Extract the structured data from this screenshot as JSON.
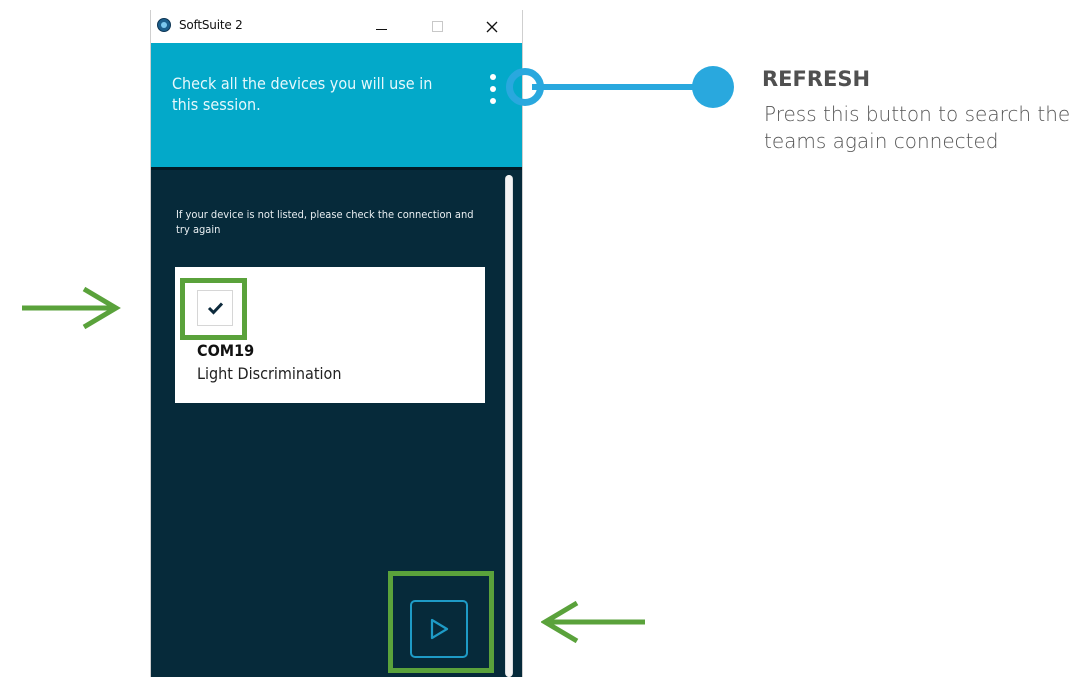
{
  "window": {
    "title": "SoftSuite 2"
  },
  "header": {
    "instruction": "Check all the devices you will use in this session.",
    "menu_icon": "more-vertical-icon"
  },
  "content": {
    "hint": "If your device is not listed, please check the connection and try again",
    "devices": [
      {
        "name": "COM19",
        "type": "Light Discrimination",
        "checked": true
      }
    ],
    "play_icon": "play-icon"
  },
  "callout": {
    "title": "REFRESH",
    "description": "Press this button to search the teams again connected"
  },
  "colors": {
    "header_bg": "#03a9c9",
    "content_bg": "#062a3a",
    "highlight": "#5aa23b",
    "callout": "#29a8de"
  }
}
